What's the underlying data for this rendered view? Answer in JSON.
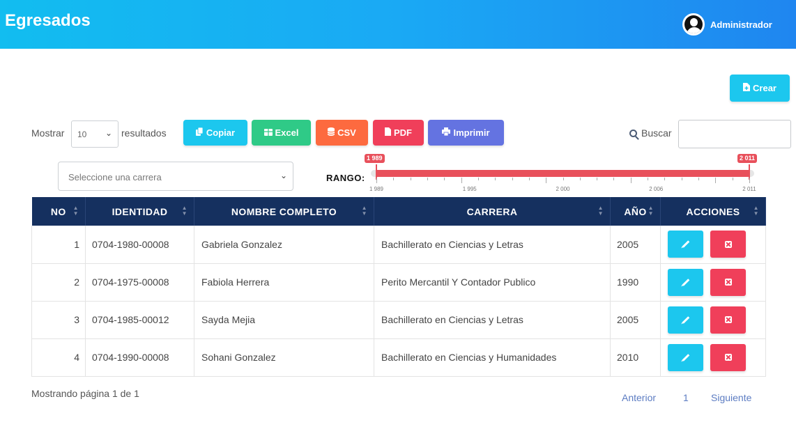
{
  "header": {
    "title": "Egresados",
    "user_name": "Administrador"
  },
  "toolbar": {
    "crear_label": "Crear",
    "show_label": "Mostrar",
    "show_value": "10",
    "results_label": "resultados",
    "export_buttons": [
      {
        "label": "Copiar",
        "color": "#1cc7ee",
        "icon": "copy-icon"
      },
      {
        "label": "Excel",
        "color": "#2fca87",
        "icon": "table-icon"
      },
      {
        "label": "CSV",
        "color": "#fd6a3f",
        "icon": "database-icon"
      },
      {
        "label": "PDF",
        "color": "#f03f5a",
        "icon": "file-icon"
      },
      {
        "label": "Imprimir",
        "color": "#6473e1",
        "icon": "print-icon"
      }
    ],
    "search_label": "Buscar"
  },
  "filter": {
    "carrera_placeholder": "Seleccione una carrera",
    "rango_label": "RANGO:",
    "range_min_value": "1 989",
    "range_max_value": "2 011",
    "range_ticks": [
      "1 989",
      "1 995",
      "2 000",
      "2 006",
      "2 011"
    ]
  },
  "table": {
    "columns": [
      "NO",
      "IDENTIDAD",
      "NOMBRE COMPLETO",
      "CARRERA",
      "AÑO",
      "ACCIONES"
    ],
    "rows": [
      {
        "no": "1",
        "identidad": "0704-1980-00008",
        "nombre": "Gabriela Gonzalez",
        "carrera": "Bachillerato en Ciencias y Letras",
        "anio": "2005"
      },
      {
        "no": "2",
        "identidad": "0704-1975-00008",
        "nombre": "Fabiola Herrera",
        "carrera": "Perito Mercantil Y Contador Publico",
        "anio": "1990"
      },
      {
        "no": "3",
        "identidad": "0704-1985-00012",
        "nombre": "Sayda Mejia",
        "carrera": "Bachillerato en Ciencias y Letras",
        "anio": "2005"
      },
      {
        "no": "4",
        "identidad": "0704-1990-00008",
        "nombre": "Sohani Gonzalez",
        "carrera": "Bachillerato en Ciencias y Humanidades",
        "anio": "2010"
      }
    ]
  },
  "footer": {
    "info": "Mostrando página 1 de 1",
    "prev": "Anterior",
    "page": "1",
    "next": "Siguiente"
  },
  "colors": {
    "header_start": "#12bdf0",
    "header_end": "#1f86f0",
    "table_head": "#15305f",
    "range": "#e8505b"
  }
}
